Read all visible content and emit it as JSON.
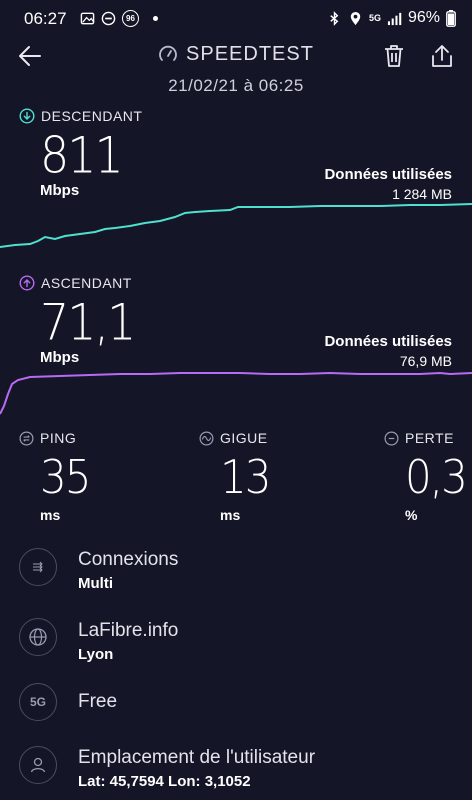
{
  "status_bar": {
    "time": "06:27",
    "badge": "96",
    "network": "5G",
    "battery": "96%"
  },
  "header": {
    "title": "SPEEDTEST",
    "date": "21/02/21 à 06:25"
  },
  "download": {
    "label": "DESCENDANT",
    "value": "811",
    "unit": "Mbps",
    "data_used_label": "Données utilisées",
    "data_used_value": "1 284 MB",
    "accent": "#4fe0d0"
  },
  "upload": {
    "label": "ASCENDANT",
    "value": "71,1",
    "unit": "Mbps",
    "data_used_label": "Données utilisées",
    "data_used_value": "76,9 MB",
    "accent": "#b86bf2"
  },
  "metrics": [
    {
      "label": "PING",
      "value": "35",
      "unit": "ms"
    },
    {
      "label": "GIGUE",
      "value": "13",
      "unit": "ms"
    },
    {
      "label": "PERTE",
      "value": "0,3",
      "unit": "%"
    }
  ],
  "info": [
    {
      "icon": "connections-icon",
      "title": "Connexions",
      "sub": "Multi"
    },
    {
      "icon": "globe-icon",
      "title": "LaFibre.info",
      "sub": "Lyon"
    },
    {
      "icon": "network-5g-icon",
      "icon_text": "5G",
      "title": "Free",
      "sub": ""
    },
    {
      "icon": "user-location-icon",
      "title": "Emplacement de l'utilisateur",
      "sub": "Lat: 45,7594 Lon: 3,1052"
    }
  ]
}
